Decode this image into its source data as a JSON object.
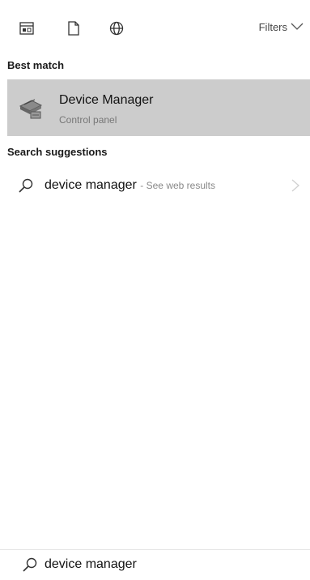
{
  "toolbar": {
    "icons": [
      "apps-icon",
      "documents-icon",
      "web-icon"
    ],
    "filters_label": "Filters"
  },
  "best_match": {
    "heading": "Best match",
    "item": {
      "title": "Device Manager",
      "subtitle": "Control panel"
    }
  },
  "suggestions": {
    "heading": "Search suggestions",
    "items": [
      {
        "query": "device manager",
        "hint": "- See web results"
      }
    ]
  },
  "search": {
    "value": "device manager"
  }
}
